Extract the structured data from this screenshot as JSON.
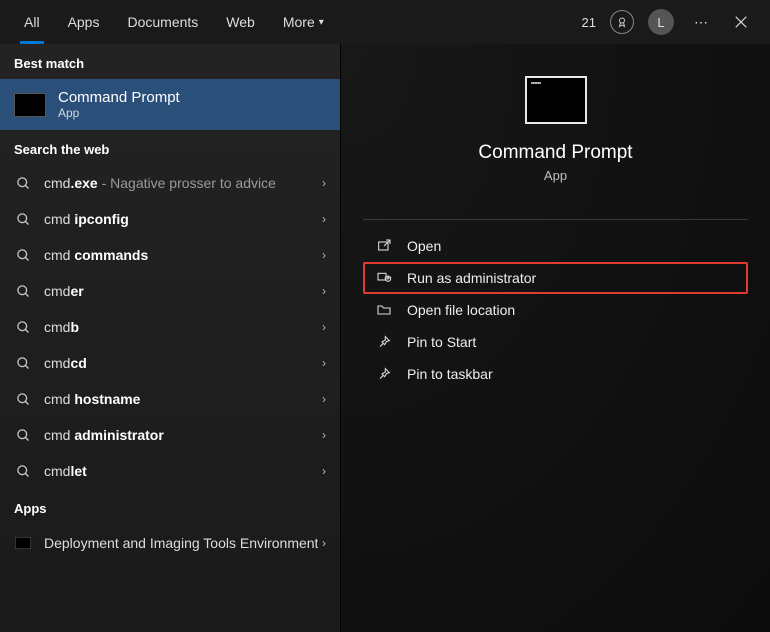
{
  "topbar": {
    "tabs": [
      {
        "label": "All",
        "active": true
      },
      {
        "label": "Apps",
        "active": false
      },
      {
        "label": "Documents",
        "active": false
      },
      {
        "label": "Web",
        "active": false
      },
      {
        "label": "More",
        "active": false,
        "dropdown": true
      }
    ],
    "badge_count": "21",
    "avatar_initial": "L"
  },
  "left": {
    "best_match_header": "Best match",
    "best_match": {
      "title": "Command Prompt",
      "subtitle": "App"
    },
    "search_web_header": "Search the web",
    "web_results": [
      {
        "prefix": "cmd",
        "bold": ".exe",
        "desc": " - Nagative prosser to advice"
      },
      {
        "prefix": "cmd ",
        "bold": "ipconfig",
        "desc": ""
      },
      {
        "prefix": "cmd ",
        "bold": "commands",
        "desc": ""
      },
      {
        "prefix": "cmd",
        "bold": "er",
        "desc": ""
      },
      {
        "prefix": "cmd",
        "bold": "b",
        "desc": ""
      },
      {
        "prefix": "cmd",
        "bold": "cd",
        "desc": ""
      },
      {
        "prefix": "cmd ",
        "bold": "hostname",
        "desc": ""
      },
      {
        "prefix": "cmd ",
        "bold": "administrator",
        "desc": ""
      },
      {
        "prefix": "cmd",
        "bold": "let",
        "desc": ""
      }
    ],
    "apps_header": "Apps",
    "app_results": [
      {
        "title": "Deployment and Imaging Tools Environment"
      }
    ]
  },
  "preview": {
    "title": "Command Prompt",
    "subtitle": "App",
    "actions": [
      {
        "icon": "open",
        "label": "Open",
        "highlight": false
      },
      {
        "icon": "admin",
        "label": "Run as administrator",
        "highlight": true
      },
      {
        "icon": "folder",
        "label": "Open file location",
        "highlight": false
      },
      {
        "icon": "pin",
        "label": "Pin to Start",
        "highlight": false
      },
      {
        "icon": "pin",
        "label": "Pin to taskbar",
        "highlight": false
      }
    ]
  }
}
